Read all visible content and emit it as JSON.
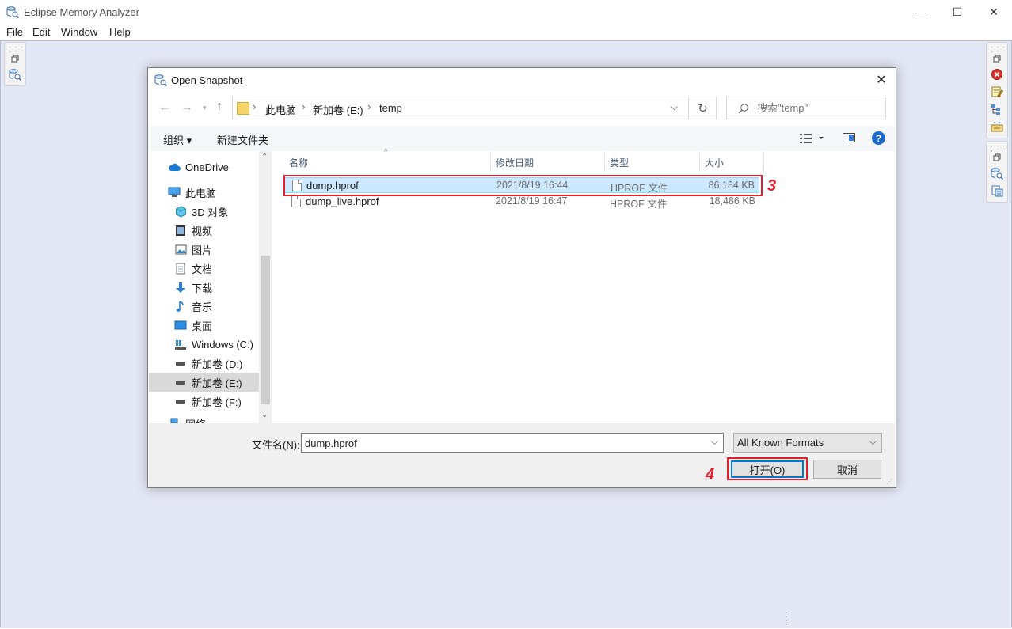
{
  "window": {
    "title": "Eclipse Memory Analyzer",
    "controls": {
      "minimize": "—",
      "maximize": "☐",
      "close": "✕"
    }
  },
  "menu": [
    "File",
    "Edit",
    "Window",
    "Help"
  ],
  "dialog": {
    "title": "Open Snapshot",
    "close": "✕",
    "breadcrumb": [
      "此电脑",
      "新加卷 (E:)",
      "temp"
    ],
    "search_placeholder": "搜索\"temp\"",
    "toolbar": {
      "organize": "组织 ▾",
      "new_folder": "新建文件夹"
    },
    "nav": {
      "onedrive": "OneDrive",
      "this_pc": "此电脑",
      "items": [
        "3D 对象",
        "视频",
        "图片",
        "文档",
        "下载",
        "音乐",
        "桌面",
        "Windows (C:)",
        "新加卷 (D:)",
        "新加卷 (E:)",
        "新加卷 (F:)"
      ],
      "network": "网络",
      "selected": "新加卷 (E:)"
    },
    "columns": [
      "名称",
      "修改日期",
      "类型",
      "大小"
    ],
    "files": [
      {
        "name": "dump.hprof",
        "date": "2021/8/19 16:44",
        "type": "HPROF 文件",
        "size": "86,184 KB",
        "selected": true
      },
      {
        "name": "dump_live.hprof",
        "date": "2021/8/19 16:47",
        "type": "HPROF 文件",
        "size": "18,486 KB",
        "selected": false
      }
    ],
    "filename_label": "文件名(N):",
    "filename_value": "dump.hprof",
    "filetype": "All Known Formats",
    "open_button": "打开(O)",
    "cancel_button": "取消"
  },
  "annotations": {
    "step3": "3",
    "step4": "4"
  },
  "colors": {
    "workbench": "#e3e6f3",
    "selection": "#cce8ff",
    "highlight_box": "#e0202c",
    "default_button": "#0078d7"
  }
}
